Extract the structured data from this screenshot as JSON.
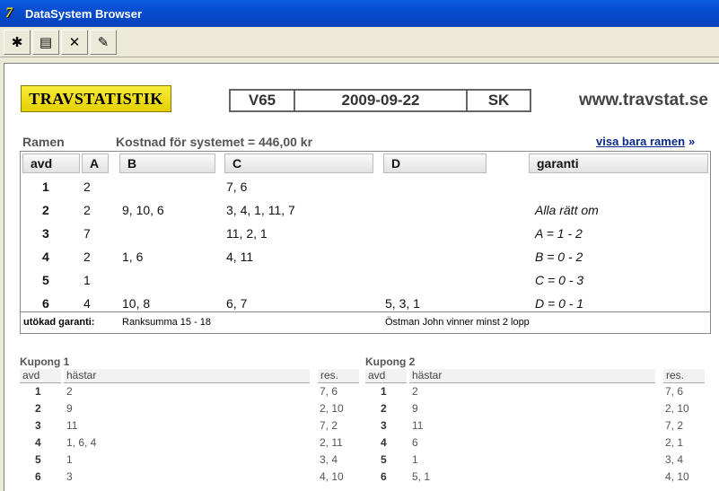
{
  "window": {
    "title": "DataSystem Browser"
  },
  "toolbar": {
    "buttons": [
      {
        "name": "bug-icon",
        "glyph": "✱"
      },
      {
        "name": "print-icon",
        "glyph": "▤"
      },
      {
        "name": "close-icon",
        "glyph": "✕"
      },
      {
        "name": "eraser-icon",
        "glyph": "✎"
      }
    ]
  },
  "header": {
    "logo": "TRAVSTATISTIK",
    "game": "V65",
    "date": "2009-09-22",
    "track": "SK",
    "site": "www.travstat.se"
  },
  "frame": {
    "label": "Ramen",
    "cost": "Kostnad för systemet = 446,00 kr",
    "show_link": "visa bara ramen",
    "show_link_arrow": "»",
    "headers": {
      "avd": "avd",
      "A": "A",
      "B": "B",
      "C": "C",
      "D": "D",
      "garanti": "garanti"
    },
    "rows": [
      {
        "avd": "1",
        "A": "2",
        "B": "",
        "C": "7, 6",
        "D": "",
        "garanti": ""
      },
      {
        "avd": "2",
        "A": "2",
        "B": "9, 10, 6",
        "C": "3, 4, 1, 11, 7",
        "D": "",
        "garanti": "Alla rätt om"
      },
      {
        "avd": "3",
        "A": "7",
        "B": "",
        "C": "11, 2, 1",
        "D": "",
        "garanti": "A = 1 - 2"
      },
      {
        "avd": "4",
        "A": "2",
        "B": "1, 6",
        "C": "4, 11",
        "D": "",
        "garanti": "B = 0 - 2"
      },
      {
        "avd": "5",
        "A": "1",
        "B": "",
        "C": "",
        "D": "",
        "garanti": "C = 0 - 3"
      },
      {
        "avd": "6",
        "A": "4",
        "B": "10, 8",
        "C": "6, 7",
        "D": "5, 3, 1",
        "garanti": "D = 0 - 1"
      }
    ],
    "extended": {
      "label": "utökad garanti:",
      "rank": "Ranksumma 15 - 18",
      "condition": "Östman John vinner minst 2 lopp"
    }
  },
  "coupons": [
    {
      "title": "Kupong 1",
      "headers": {
        "avd": "avd",
        "horses": "hästar",
        "res": "res."
      },
      "rows": [
        {
          "avd": "1",
          "horses": "2",
          "res": "7, 6"
        },
        {
          "avd": "2",
          "horses": "9",
          "res": "2, 10"
        },
        {
          "avd": "3",
          "horses": "11",
          "res": "7, 2"
        },
        {
          "avd": "4",
          "horses": "1, 6, 4",
          "res": "2, 11"
        },
        {
          "avd": "5",
          "horses": "1",
          "res": "3, 4"
        },
        {
          "avd": "6",
          "horses": "3",
          "res": "4, 10"
        }
      ]
    },
    {
      "title": "Kupong 2",
      "headers": {
        "avd": "avd",
        "horses": "hästar",
        "res": "res."
      },
      "rows": [
        {
          "avd": "1",
          "horses": "2",
          "res": "7, 6"
        },
        {
          "avd": "2",
          "horses": "9",
          "res": "2, 10"
        },
        {
          "avd": "3",
          "horses": "11",
          "res": "7, 2"
        },
        {
          "avd": "4",
          "horses": "6",
          "res": "2, 1"
        },
        {
          "avd": "5",
          "horses": "1",
          "res": "3, 4"
        },
        {
          "avd": "6",
          "horses": "5, 1",
          "res": "4, 10"
        }
      ]
    }
  ]
}
